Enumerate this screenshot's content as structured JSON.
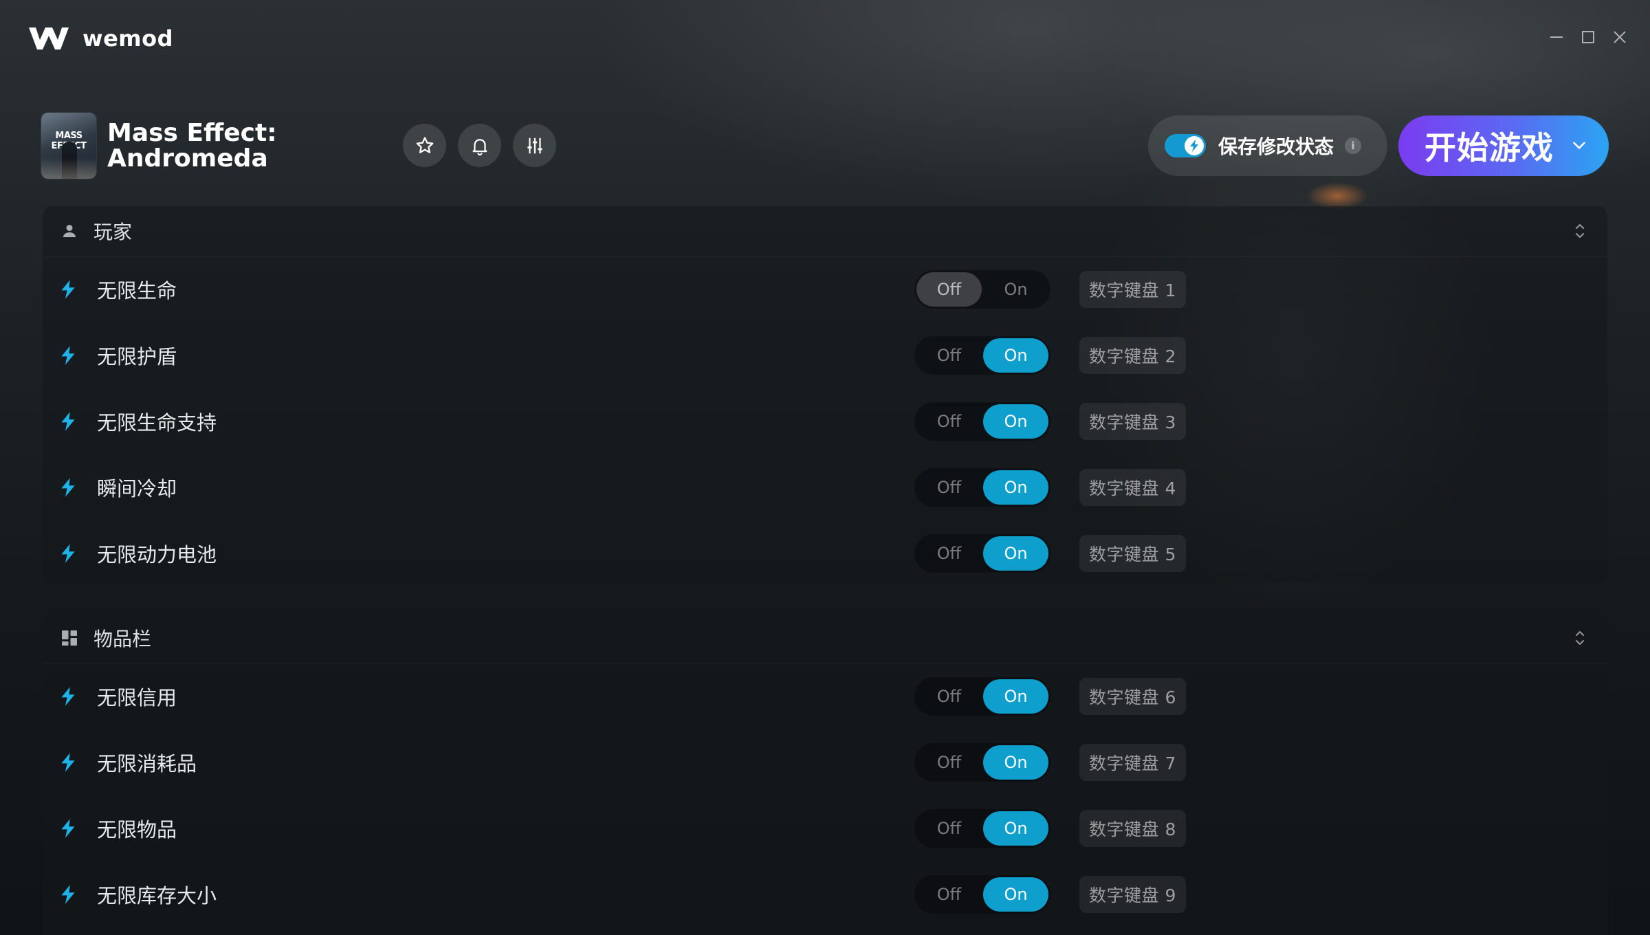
{
  "app": {
    "name": "wemod"
  },
  "game": {
    "title_line1": "Mass Effect:",
    "title_line2": "Andromeda",
    "cover_text": "MASS EFFECT"
  },
  "header": {
    "save_mods_label": "保存修改状态",
    "save_mods_enabled": true,
    "info_icon_text": "i",
    "play_label": "开始游戏"
  },
  "toggle_labels": {
    "off": "Off",
    "on": "On"
  },
  "sections": [
    {
      "title": "玩家",
      "icon": "person-icon",
      "mods": [
        {
          "name": "无限生命",
          "state": "off",
          "hotkey": "数字键盘 1"
        },
        {
          "name": "无限护盾",
          "state": "on",
          "hotkey": "数字键盘 2"
        },
        {
          "name": "无限生命支持",
          "state": "on",
          "hotkey": "数字键盘 3"
        },
        {
          "name": "瞬间冷却",
          "state": "on",
          "hotkey": "数字键盘 4"
        },
        {
          "name": "无限动力电池",
          "state": "on",
          "hotkey": "数字键盘 5"
        }
      ]
    },
    {
      "title": "物品栏",
      "icon": "grid-icon",
      "mods": [
        {
          "name": "无限信用",
          "state": "on",
          "hotkey": "数字键盘 6"
        },
        {
          "name": "无限消耗品",
          "state": "on",
          "hotkey": "数字键盘 7"
        },
        {
          "name": "无限物品",
          "state": "on",
          "hotkey": "数字键盘 8"
        },
        {
          "name": "无限库存大小",
          "state": "on",
          "hotkey": "数字键盘 9"
        }
      ]
    }
  ],
  "colors": {
    "accent": "#0e9fcc",
    "play_gradient_start": "#7a3cf0",
    "play_gradient_end": "#2ba4f2",
    "bolt": "#1fb3e8"
  }
}
